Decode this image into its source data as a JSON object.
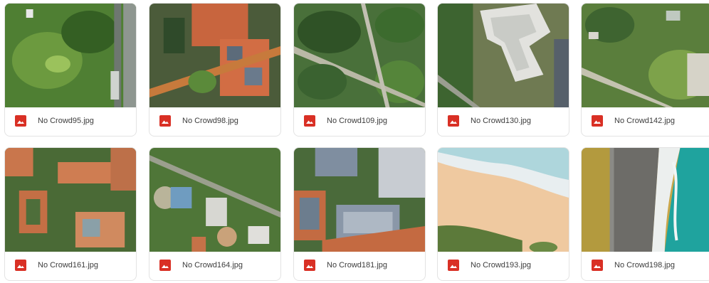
{
  "files": [
    {
      "name": "No Crowd95.jpg"
    },
    {
      "name": "No Crowd98.jpg"
    },
    {
      "name": "No Crowd109.jpg"
    },
    {
      "name": "No Crowd130.jpg"
    },
    {
      "name": "No Crowd142.jpg"
    },
    {
      "name": "No Crowd161.jpg"
    },
    {
      "name": "No Crowd164.jpg"
    },
    {
      "name": "No Crowd181.jpg"
    },
    {
      "name": "No Crowd193.jpg"
    },
    {
      "name": "No Crowd198.jpg"
    }
  ],
  "icon": {
    "name": "image-file-icon",
    "color": "#d93025"
  }
}
